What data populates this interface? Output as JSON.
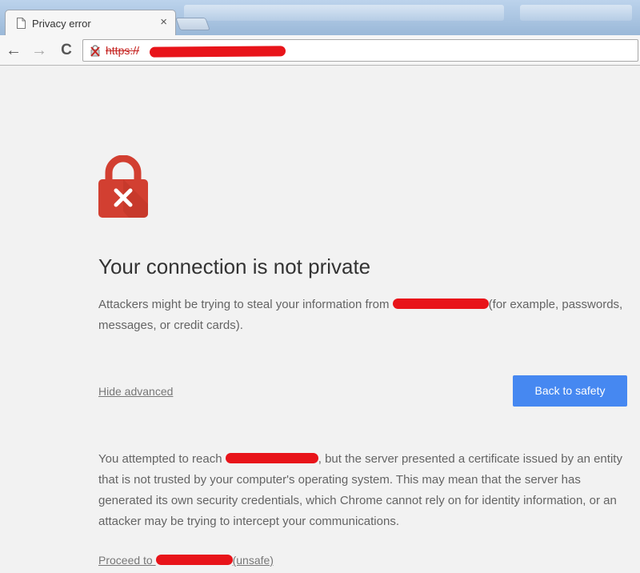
{
  "browser": {
    "tab": {
      "title": "Privacy error",
      "close_glyph": "×"
    },
    "nav": {
      "back_glyph": "←",
      "forward_glyph": "→",
      "reload_glyph": "C"
    },
    "address_bar": {
      "scheme": "https://"
    },
    "icons": {
      "tab": "page-icon",
      "security": "broken-lock-icon"
    },
    "colors": {
      "frame": "#9ab8d8",
      "insecure": "#c5221f"
    }
  },
  "interstitial": {
    "icon": "red-padlock-x-icon",
    "heading": "Your connection is not private",
    "explanation": {
      "before": "Attackers might be trying to steal your information from ",
      "after": "(for example, passwords, messages, or credit cards)."
    },
    "hide_advanced_label": "Hide advanced",
    "back_to_safety_label": "Back to safety",
    "details": {
      "before": "You attempted to reach ",
      "after": ", but the server presented a certificate issued by an entity that is not trusted by your computer's operating system. This may mean that the server has generated its own security credentials, which Chrome cannot rely on for identity information, or an attacker may be trying to intercept your communications."
    },
    "proceed": {
      "before": "Proceed to ",
      "after": "(unsafe)"
    },
    "colors": {
      "primary_button": "#4688f1",
      "lock": "#d23f31",
      "redaction": "#e8141a"
    }
  }
}
